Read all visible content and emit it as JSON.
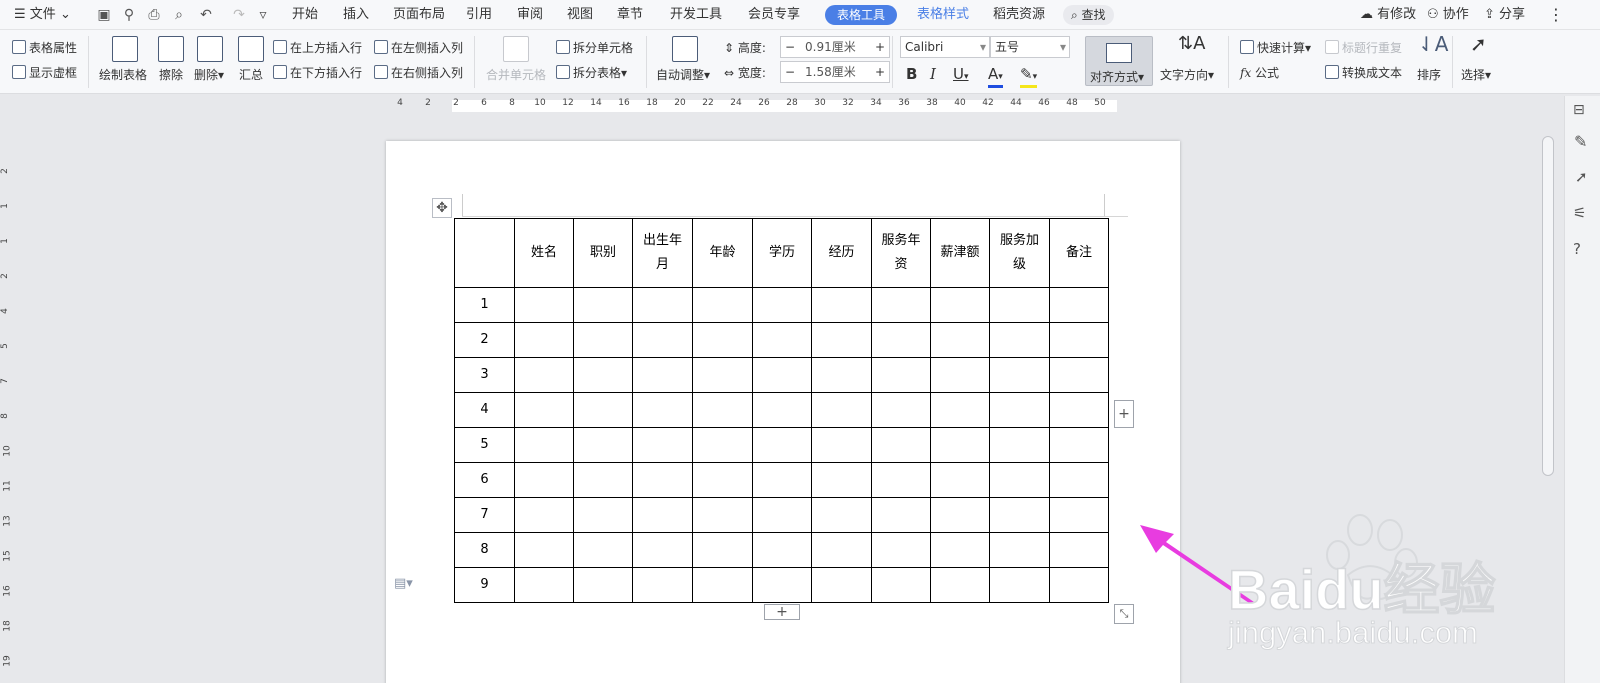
{
  "titlebar": {
    "file_menu": "文件",
    "tabs": [
      "开始",
      "插入",
      "页面布局",
      "引用",
      "审阅",
      "视图",
      "章节",
      "开发工具",
      "会员专享"
    ],
    "active_tab": "表格工具",
    "tab_table_style": "表格样式",
    "tab_resources": "稻壳资源",
    "search": "查找",
    "right_actions": [
      "有修改",
      "协作",
      "分享"
    ],
    "accent_color": "#4a7fe6"
  },
  "ribbon": {
    "table_props": "表格属性",
    "show_gridlines": "显示虚框",
    "draw_table": "绘制表格",
    "erase": "擦除",
    "delete": "删除",
    "summary": "汇总",
    "insert_above": "在上方插入行",
    "insert_below": "在下方插入行",
    "insert_left": "在左侧插入列",
    "insert_right": "在右侧插入列",
    "merge_cells": "合并单元格",
    "split_cells": "拆分单元格",
    "split_table": "拆分表格",
    "auto_fit": "自动调整",
    "height_label": "高度:",
    "height_value": "0.91厘米",
    "width_label": "宽度:",
    "width_value": "1.58厘米",
    "font_name": "Calibri",
    "font_size": "五号",
    "align": "对齐方式",
    "text_direction": "文字方向",
    "quick_calc": "快速计算",
    "repeat_header": "标题行重复",
    "formula": "公式",
    "to_text": "转换成文本",
    "sort": "排序",
    "select": "选择"
  },
  "ruler": {
    "h_ticks": [
      "4",
      "2",
      "2",
      "6",
      "8",
      "10",
      "12",
      "14",
      "16",
      "18",
      "20",
      "22",
      "24",
      "26",
      "28",
      "30",
      "32",
      "34",
      "36",
      "38",
      "40",
      "42",
      "44",
      "46",
      "48",
      "50"
    ],
    "v_ticks": [
      "2",
      "1",
      "1",
      "2",
      "4",
      "5",
      "7",
      "8",
      "10",
      "11",
      "13",
      "15",
      "16",
      "18",
      "19"
    ]
  },
  "table": {
    "headers": [
      "",
      "姓名",
      "职别",
      "出生年月",
      "年龄",
      "学历",
      "经历",
      "服务年资",
      "薪津额",
      "服务加级",
      "备注"
    ],
    "rows": [
      "1",
      "2",
      "3",
      "4",
      "5",
      "6",
      "7",
      "8",
      "9"
    ]
  },
  "watermark": {
    "brand": "Baidu经验",
    "url": "jingyan.baidu.com"
  },
  "colors": {
    "arrow": "#e83ce0",
    "page": "#ffffff",
    "workspace": "#e7e8eb"
  }
}
